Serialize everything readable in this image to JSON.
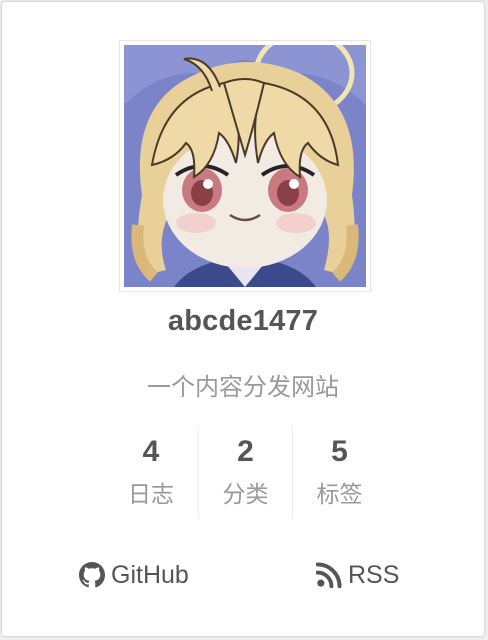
{
  "author": {
    "name": "abcde1477",
    "description": "一个内容分发网站"
  },
  "stats": [
    {
      "count": "4",
      "label": "日志"
    },
    {
      "count": "2",
      "label": "分类"
    },
    {
      "count": "5",
      "label": "标签"
    }
  ],
  "links": [
    {
      "label": "GitHub",
      "icon": "github-icon"
    },
    {
      "label": "RSS",
      "icon": "rss-icon"
    }
  ],
  "colors": {
    "text_dark": "#555555",
    "text_muted": "#999999",
    "divider": "#eeeeee"
  }
}
